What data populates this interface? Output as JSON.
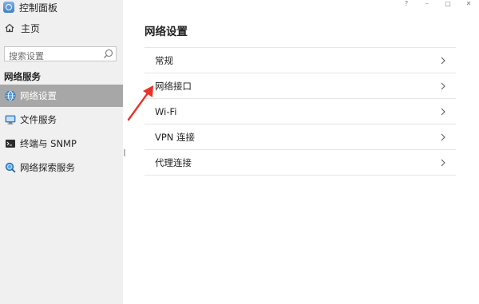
{
  "window": {
    "controls": [
      "?",
      "–",
      "□",
      "✕"
    ]
  },
  "sidebar": {
    "app_title": "控制面板",
    "home_label": "主页",
    "search_placeholder": "搜索设置",
    "section_header": "网络服务",
    "items": [
      {
        "label": "网络设置",
        "icon": "globe-network-icon",
        "selected": true
      },
      {
        "label": "文件服务",
        "icon": "monitor-folder-icon",
        "selected": false
      },
      {
        "label": "终端与 SNMP",
        "icon": "terminal-icon",
        "selected": false
      },
      {
        "label": "网络探索服务",
        "icon": "magnifier-globe-icon",
        "selected": false
      }
    ]
  },
  "main": {
    "title": "网络设置",
    "rows": [
      {
        "label": "常规"
      },
      {
        "label": "网络接口"
      },
      {
        "label": "Wi-Fi"
      },
      {
        "label": "VPN 连接"
      },
      {
        "label": "代理连接"
      }
    ]
  },
  "colors": {
    "sidebar_bg": "#f0f0f0",
    "selected_bg": "#a7a7a7",
    "annotation_arrow": "#e8322a"
  }
}
